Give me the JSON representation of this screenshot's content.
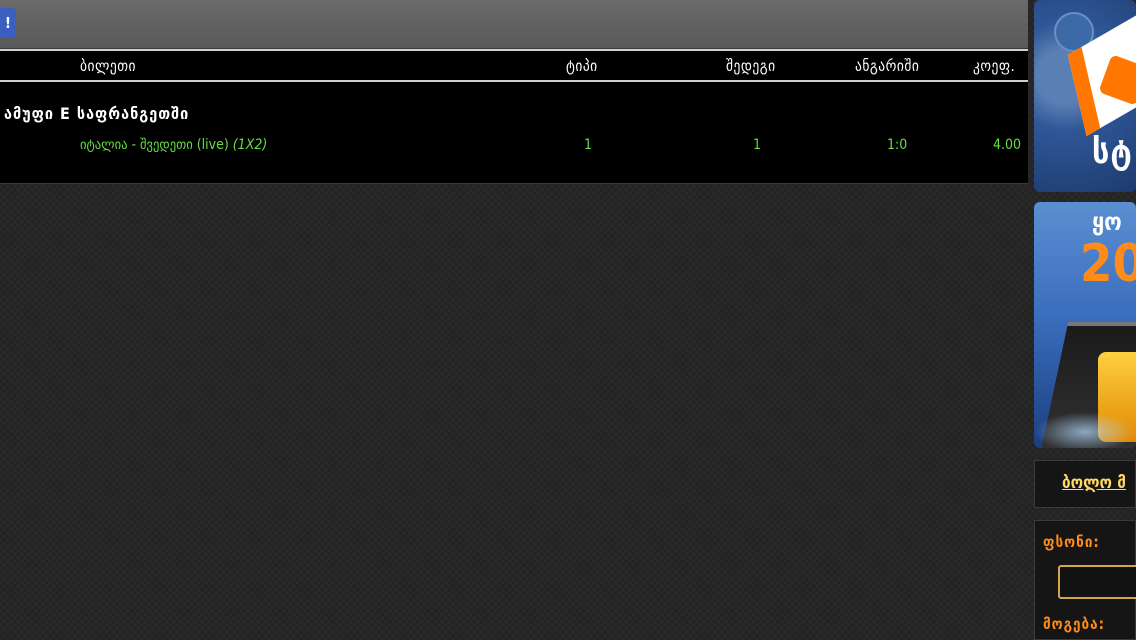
{
  "topbar": {
    "button_label": "!"
  },
  "table": {
    "headers": {
      "ticket": "ბილეთი",
      "type": "ტიპი",
      "result": "შედეგი",
      "score": "ანგარიში",
      "coef": "კოეფ."
    },
    "group_title": "ამუფი E საფრანგეთში",
    "rows": [
      {
        "match": "იტალია - შვედეთი (live)",
        "bet_type": "(1X2)",
        "type": "1",
        "result": "1",
        "score": "1:0",
        "odds": "4.00"
      }
    ]
  },
  "sidebar": {
    "banner1_text": "სტ",
    "banner2_line1": "ყო",
    "banner2_line2": "20",
    "link_label": "ბოლო მ",
    "login": {
      "password_label": "ფსონი:",
      "password_value": "",
      "winnings_label": "მოგება:"
    }
  },
  "colors": {
    "accent_green": "#66dd44",
    "accent_orange": "#ff8c1a",
    "link_yellow": "#ffd966",
    "button_blue": "#3b5fc0"
  }
}
